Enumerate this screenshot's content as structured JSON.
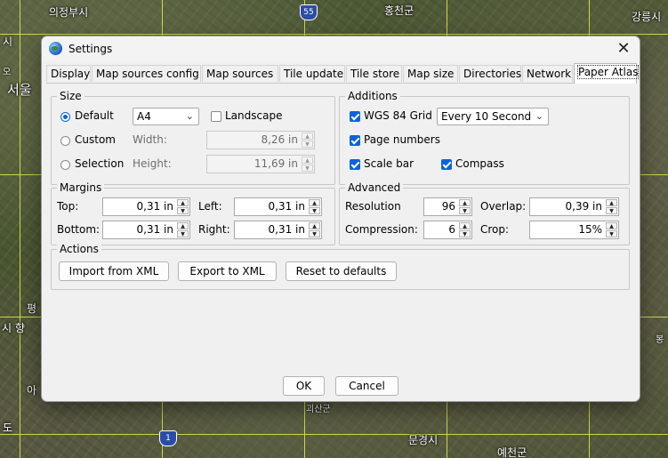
{
  "map": {
    "labels": {
      "uijeongbu": "의정부시",
      "hongcheon": "홍천군",
      "gangneung": "강릉시",
      "seoul": "서울",
      "left_top": "시",
      "left_small1": "오",
      "pyeong": "평",
      "sihyang": "시 향",
      "ah": "아",
      "do": "도",
      "goesan": "괴산군",
      "mungyeong": "문경시",
      "yecheon": "예천군",
      "right_mid": "봉"
    },
    "shields": {
      "route55": "55",
      "route1": "1"
    }
  },
  "dialog": {
    "title": "Settings",
    "close_glyph": "✕",
    "tabs": [
      {
        "label": "Display"
      },
      {
        "label": "Map sources config"
      },
      {
        "label": "Map sources"
      },
      {
        "label": "Tile update"
      },
      {
        "label": "Tile store"
      },
      {
        "label": "Map size"
      },
      {
        "label": "Directories"
      },
      {
        "label": "Network"
      },
      {
        "label": "Paper Atlas"
      }
    ],
    "active_tab": "Paper Atlas",
    "size": {
      "legend": "Size",
      "default_label": "Default",
      "custom_label": "Custom",
      "selection_label": "Selection",
      "selected_option": "Default",
      "paper_value": "A4",
      "landscape_label": "Landscape",
      "landscape_checked": false,
      "width_label": "Width:",
      "width_value": "8,26 in",
      "height_label": "Height:",
      "height_value": "11,69 in"
    },
    "additions": {
      "legend": "Additions",
      "wgs_label": "WGS 84 Grid",
      "wgs_checked": true,
      "grid_interval": "Every 10 Second",
      "page_numbers_label": "Page numbers",
      "page_numbers_checked": true,
      "scale_bar_label": "Scale bar",
      "scale_bar_checked": true,
      "compass_label": "Compass",
      "compass_checked": true
    },
    "margins": {
      "legend": "Margins",
      "top_label": "Top:",
      "top_value": "0,31 in",
      "left_label": "Left:",
      "left_value": "0,31 in",
      "bottom_label": "Bottom:",
      "bottom_value": "0,31 in",
      "right_label": "Right:",
      "right_value": "0,31 in"
    },
    "advanced": {
      "legend": "Advanced",
      "resolution_label": "Resolution",
      "resolution_value": "96",
      "overlap_label": "Overlap:",
      "overlap_value": "0,39 in",
      "compression_label": "Compression:",
      "compression_value": "6",
      "crop_label": "Crop:",
      "crop_value": "15%"
    },
    "actions": {
      "legend": "Actions",
      "import_label": "Import from XML",
      "export_label": "Export to XML",
      "reset_label": "Reset to defaults"
    },
    "footer": {
      "ok_label": "OK",
      "cancel_label": "Cancel"
    },
    "colors": {
      "accent": "#0a64d8",
      "dialog_bg": "#f0f0f0",
      "grid_line": "#d8e54a"
    }
  }
}
